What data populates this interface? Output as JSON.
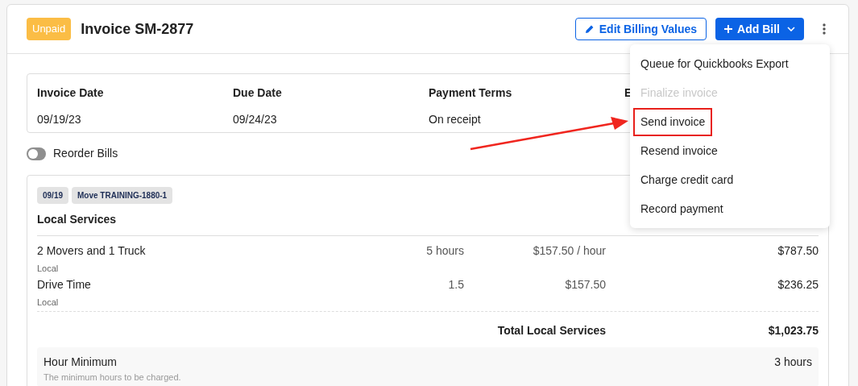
{
  "header": {
    "status_badge": "Unpaid",
    "title": "Invoice SM-2877",
    "edit_button": "Edit Billing Values",
    "add_button": "Add Bill"
  },
  "menu": {
    "items": [
      {
        "label": "Queue for Quickbooks Export",
        "disabled": false,
        "highlighted": false
      },
      {
        "label": "Finalize invoice",
        "disabled": true,
        "highlighted": false
      },
      {
        "label": "Send invoice",
        "disabled": false,
        "highlighted": true
      },
      {
        "label": "Resend invoice",
        "disabled": false,
        "highlighted": false
      },
      {
        "label": "Charge credit card",
        "disabled": false,
        "highlighted": false
      },
      {
        "label": "Record payment",
        "disabled": false,
        "highlighted": false
      }
    ]
  },
  "info": [
    {
      "label": "Invoice Date",
      "value": "09/19/23"
    },
    {
      "label": "Due Date",
      "value": "09/24/23"
    },
    {
      "label": "Payment Terms",
      "value": "On receipt"
    },
    {
      "label": "E"
    }
  ],
  "reorder": {
    "label": "Reorder Bills",
    "on": false
  },
  "bill": {
    "tags": [
      "09/19",
      "Move TRAINING-1880-1"
    ],
    "title": "Local Services",
    "rows": [
      {
        "name": "2 Movers and 1 Truck",
        "category": "Local",
        "quantity": "5 hours",
        "rate": "$157.50 / hour",
        "amount": "$787.50"
      },
      {
        "name": "Drive Time",
        "category": "Local",
        "quantity": "1.5",
        "rate": "$157.50",
        "amount": "$236.25"
      }
    ],
    "total": {
      "label": "Total Local Services",
      "amount": "$1,023.75"
    },
    "minimum": {
      "title": "Hour Minimum",
      "description": "The minimum hours to be charged.",
      "value": "3 hours"
    }
  }
}
